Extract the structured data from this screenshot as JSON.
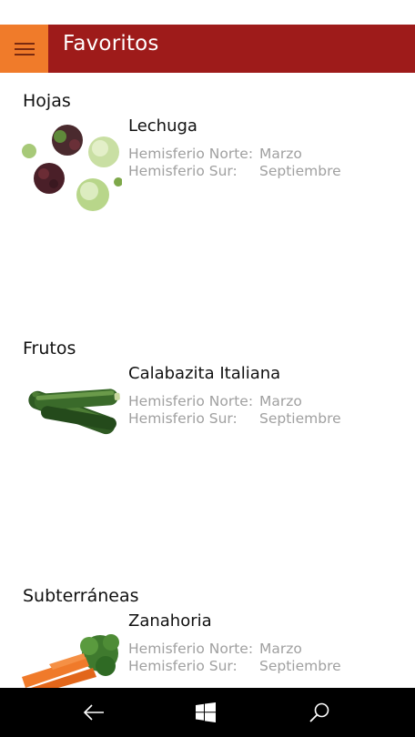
{
  "header": {
    "title": "Favoritos"
  },
  "sections": [
    {
      "title": "Hojas",
      "items": [
        {
          "name": "Lechuga",
          "north_label": "Hemisferio Norte:",
          "north_value": "Marzo",
          "south_label": "Hemisferio Sur:",
          "south_value": "Septiembre"
        }
      ]
    },
    {
      "title": "Frutos",
      "items": [
        {
          "name": "Calabazita Italiana",
          "north_label": "Hemisferio Norte:",
          "north_value": "Marzo",
          "south_label": "Hemisferio Sur:",
          "south_value": "Septiembre"
        }
      ]
    },
    {
      "title": "Subterráneas",
      "items": [
        {
          "name": "Zanahoria",
          "north_label": "Hemisferio Norte:",
          "north_value": "Marzo",
          "south_label": "Hemisferio Sur:",
          "south_value": "Septiembre"
        }
      ]
    }
  ],
  "navbar": {
    "icons": [
      "back-icon",
      "windows-start-icon",
      "search-icon"
    ]
  },
  "colors": {
    "header": "#9e1b1a",
    "hamburger": "#f07b2a",
    "navbar": "#000000",
    "meta_text": "#a0a0a0"
  }
}
